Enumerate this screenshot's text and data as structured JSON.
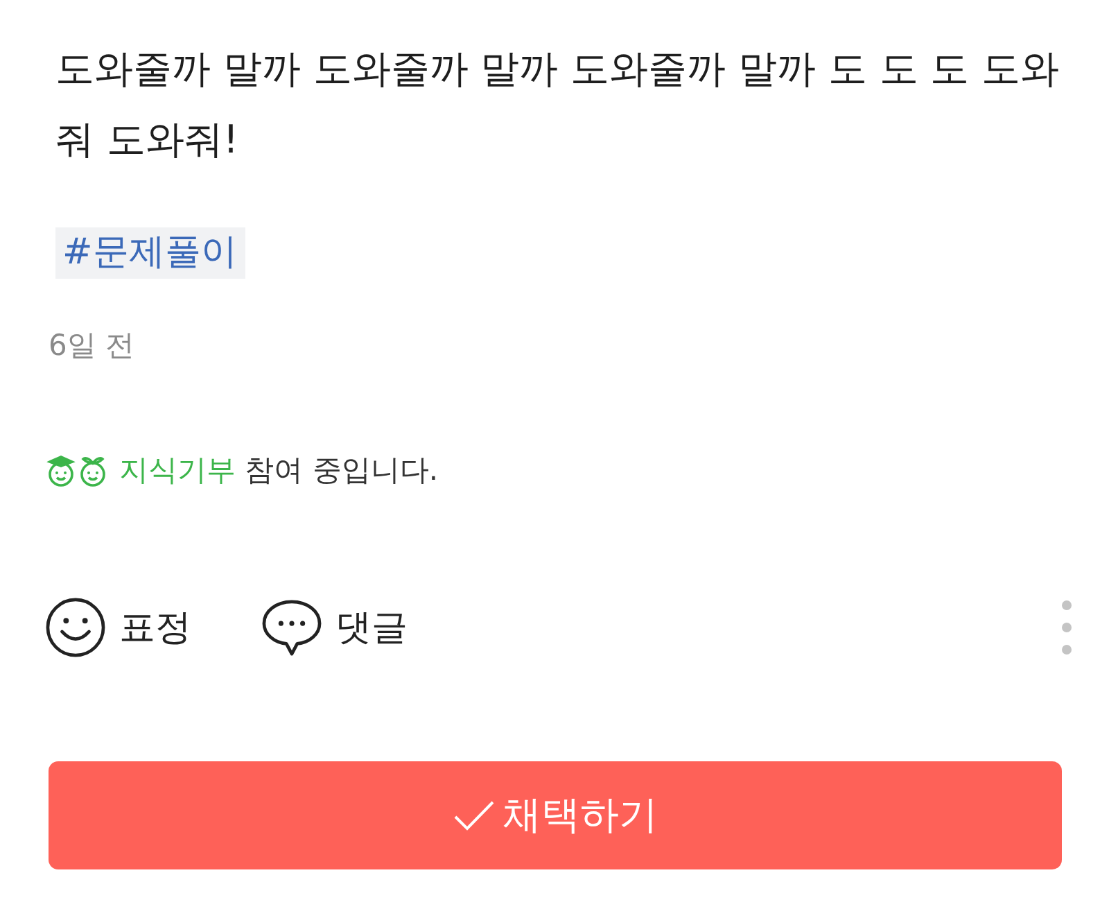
{
  "post": {
    "body": "도와줄까 말까 도와줄까 말까 도와줄까 말까 도 도 도 도와줘 도와줘!",
    "tags": [
      "#문제풀이"
    ],
    "time": "6일 전"
  },
  "donation": {
    "link": "지식기부",
    "text": "참여 중입니다."
  },
  "actions": [
    {
      "kind": "reaction",
      "label": "표정"
    },
    {
      "kind": "comment",
      "label": "댓글"
    }
  ],
  "accept_button": {
    "label": "채택하기"
  }
}
